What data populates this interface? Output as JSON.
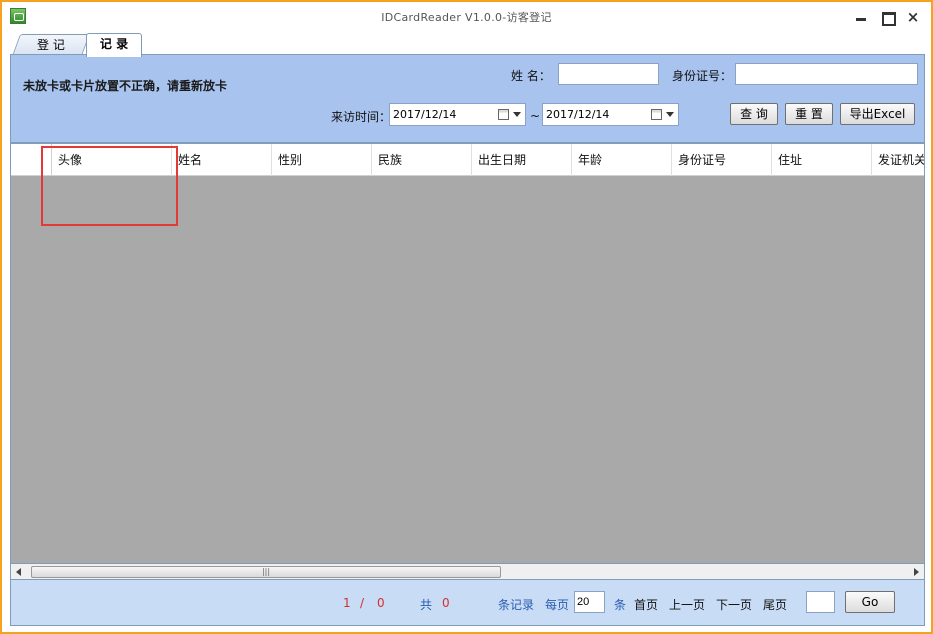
{
  "window": {
    "title": "IDCardReader  V1.0.0-访客登记"
  },
  "tabs": [
    {
      "label": "登 记"
    },
    {
      "label": "记 录"
    }
  ],
  "panel": {
    "warning": "未放卡或卡片放置不正确，请重新放卡",
    "name_label": "姓 名：",
    "name_value": "",
    "id_label": "身份证号：",
    "id_value": "",
    "visit_time_label": "来访时间：",
    "date_from": "2017/12/14",
    "tilde": "~",
    "date_to": "2017/12/14",
    "query_button": "查 询",
    "reset_button": "重 置",
    "export_button": "导出Excel"
  },
  "grid": {
    "columns": [
      "头像",
      "姓名",
      "性别",
      "民族",
      "出生日期",
      "年龄",
      "身份证号",
      "住址",
      "发证机关"
    ]
  },
  "footer": {
    "current_page": "1",
    "slash": "/",
    "total_pages": "0",
    "total_prefix": "共",
    "total_count": "0",
    "records_suffix": "条记录",
    "per_page_label": "每页",
    "per_page_value": "20",
    "per_page_unit": "条",
    "first_page": "首页",
    "prev_page": "上一页",
    "next_page": "下一页",
    "last_page": "尾页",
    "goto_value": "",
    "go_button": "Go"
  },
  "colors": {
    "accent_border": "#f7a21e",
    "panel_bg": "#a7c3ee",
    "grid_bg": "#a9a9a9",
    "highlight": "#e53935"
  }
}
